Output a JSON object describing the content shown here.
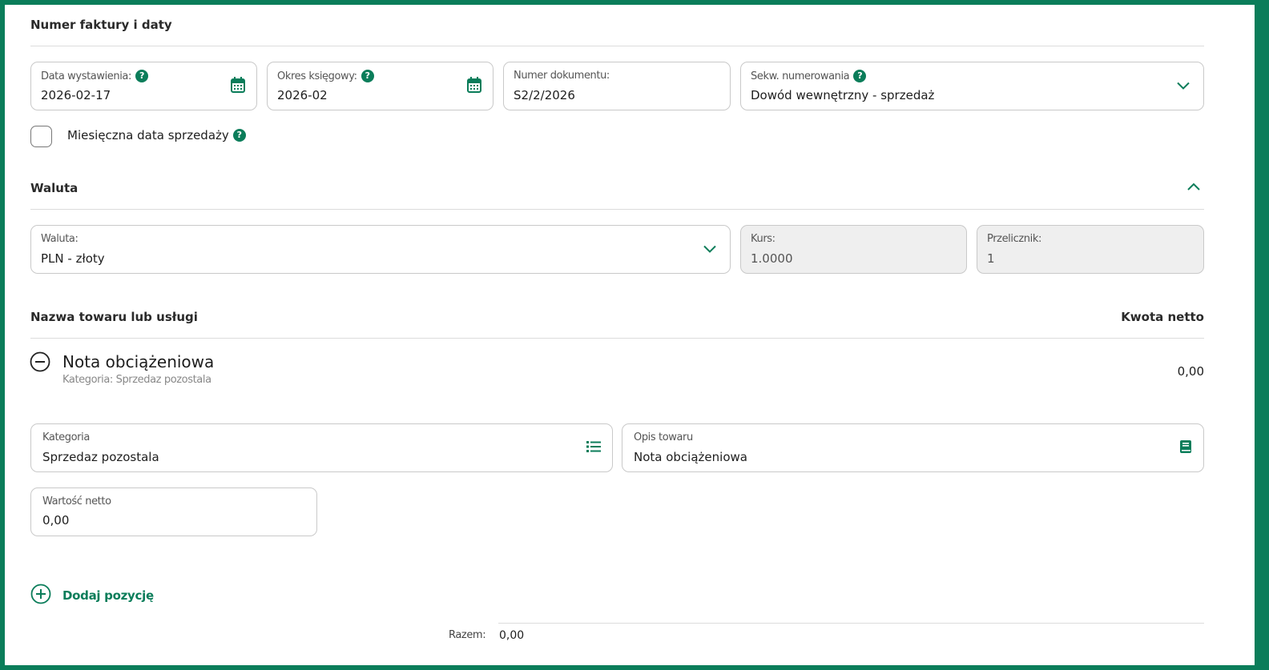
{
  "colors": {
    "accent": "#0b7d5a",
    "border": "#c9c9c9",
    "disabled_bg": "#efefef"
  },
  "invoice_section": {
    "title": "Numer faktury i daty",
    "issue_date": {
      "label": "Data wystawienia:",
      "value": "2026-02-17",
      "icon": "calendar-icon"
    },
    "accounting_period": {
      "label": "Okres księgowy:",
      "value": "2026-02",
      "icon": "calendar-icon"
    },
    "document_number": {
      "label": "Numer dokumentu:",
      "value": "S2/2/2026"
    },
    "numbering_sequence": {
      "label": "Sekw. numerowania",
      "value": "Dowód wewnętrzny - sprzedaż",
      "icon": "chevron-down-icon"
    },
    "monthly_sale_date": {
      "label": "Miesięczna data sprzedaży",
      "checked": false
    }
  },
  "currency_section": {
    "title": "Waluta",
    "collapse_icon": "chevron-up-icon",
    "currency": {
      "label": "Waluta:",
      "value": "PLN - złoty"
    },
    "rate": {
      "label": "Kurs:",
      "value": "1.0000"
    },
    "converter": {
      "label": "Przelicznik:",
      "value": "1"
    }
  },
  "items_section": {
    "col_name": "Nazwa towaru lub usługi",
    "col_net": "Kwota netto",
    "item": {
      "name": "Nota obciążeniowa",
      "subtitle": "Kategoria: Sprzedaz pozostala",
      "net": "0,00"
    },
    "category": {
      "label": "Kategoria",
      "value": "Sprzedaz pozostala",
      "icon": "list-icon"
    },
    "description": {
      "label": "Opis towaru",
      "value": "Nota obciążeniowa",
      "icon": "book-icon"
    },
    "net_value": {
      "label": "Wartość netto",
      "value": "0,00"
    },
    "add_item": "Dodaj pozycję",
    "total_label": "Razem:",
    "total_value": "0,00"
  }
}
